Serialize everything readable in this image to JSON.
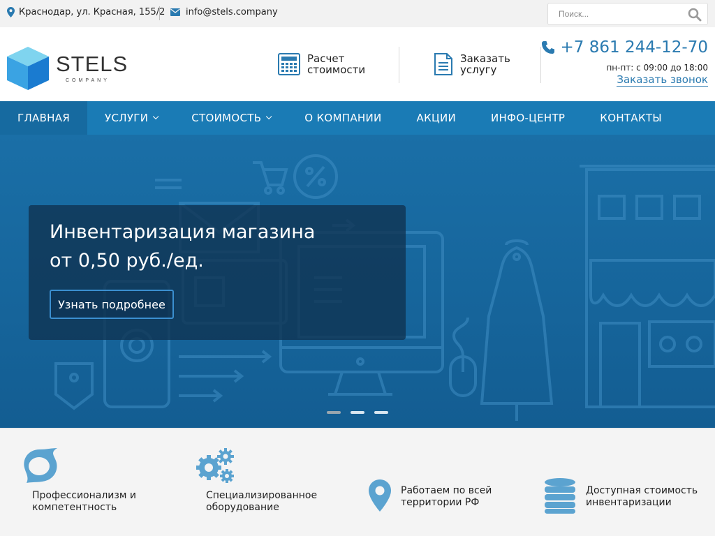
{
  "topbar": {
    "address": "Краснодар, ул. Красная, 155/2",
    "email": "info@stels.company",
    "search_placeholder": "Поиск..."
  },
  "logo": {
    "name": "STELS",
    "sub": "COMPANY"
  },
  "header": {
    "calc_line1": "Расчет",
    "calc_line2": "стоимости",
    "order_line1": "Заказать",
    "order_line2": "услугу",
    "phone": "+7 861 244-12-70",
    "hours": "пн-пт: с 09:00 до 18:00",
    "callback": "Заказать звонок"
  },
  "nav": [
    {
      "label": "ГЛАВНАЯ"
    },
    {
      "label": "УСЛУГИ"
    },
    {
      "label": "СТОИМОСТЬ"
    },
    {
      "label": "О КОМПАНИИ"
    },
    {
      "label": "АКЦИИ"
    },
    {
      "label": "ИНФО-ЦЕНТР"
    },
    {
      "label": "КОНТАКТЫ"
    }
  ],
  "hero": {
    "title_line1": "Инвентаризация магазина",
    "title_line2": "от 0,50 руб./ед.",
    "button": "Узнать подробнее"
  },
  "features": [
    {
      "line1": "Профессионализм и",
      "line2": "компетентность",
      "icon": "swirl-icon"
    },
    {
      "line1": "Специализированное",
      "line2": "оборудование",
      "icon": "gears-icon"
    },
    {
      "line1": "Работаем по всей",
      "line2": "территории РФ",
      "icon": "map-pin-icon"
    },
    {
      "line1": "Доступная стоимость",
      "line2": "инвентаризации",
      "icon": "coins-stack-icon"
    }
  ],
  "colors": {
    "accent": "#1a7bb5",
    "link": "#2a7ab0",
    "icon": "#5ba3d0"
  }
}
